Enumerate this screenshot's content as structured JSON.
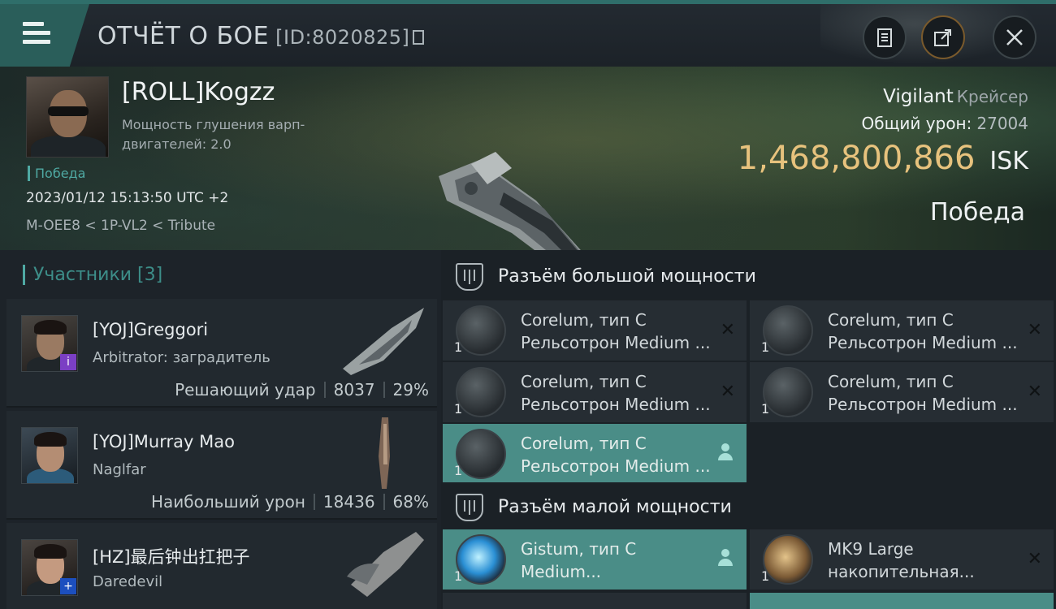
{
  "header": {
    "title": "ОТЧЁТ О БОЕ",
    "report_id": "[ID:8020825]"
  },
  "victim": {
    "pilot_name": "[ROLL]Kogzz",
    "pilot_sub": "Мощность глушения варп-двигателей: 2.0",
    "tag": "Победа",
    "timestamp": "2023/01/12 15:13:50 UTC +2",
    "location": "M-OEE8 < 1P-VL2 < Tribute",
    "ship_name": "Vigilant",
    "ship_class": "Крейсер",
    "damage_label": "Общий урон:",
    "damage_value": "27004",
    "isk_value": "1,468,800,866",
    "isk_unit": "ISK",
    "result": "Победа"
  },
  "participants": {
    "header": "Участники [3]",
    "items": [
      {
        "name": "[YOJ]Greggori",
        "ship": "Arbitrator: заградитель",
        "stat_label": "Решающий удар",
        "damage": "8037",
        "percent": "29%",
        "badge_color": "#7b3fc4",
        "badge_glyph": "i"
      },
      {
        "name": "[YOJ]Murray Mao",
        "ship": "Naglfar",
        "stat_label": "Наибольший урон",
        "damage": "18436",
        "percent": "68%"
      },
      {
        "name": "[HZ]最后钟出扛把子",
        "ship": "Daredevil",
        "badge_color": "#1c4fbf",
        "badge_glyph": "+"
      }
    ]
  },
  "fitting": {
    "high_slots_title": "Разъём большой мощности",
    "low_slots_title": "Разъём малой мощности",
    "high_modules": [
      {
        "line1": "Corelum, тип C",
        "line2": "Рельсотрон Medium ...",
        "qty": "1",
        "state": "destroyed"
      },
      {
        "line1": "Corelum, тип C",
        "line2": "Рельсотрон Medium ...",
        "qty": "1",
        "state": "destroyed"
      },
      {
        "line1": "Corelum, тип C",
        "line2": "Рельсотрон Medium ...",
        "qty": "1",
        "state": "destroyed"
      },
      {
        "line1": "Corelum, тип C",
        "line2": "Рельсотрон Medium ...",
        "qty": "1",
        "state": "destroyed"
      },
      {
        "line1": "Corelum, тип C",
        "line2": "Рельсотрон Medium ...",
        "qty": "1",
        "state": "dropped"
      }
    ],
    "low_modules": [
      {
        "line1": "Gistum, тип C",
        "line2": "Medium...",
        "qty": "1",
        "state": "dropped"
      },
      {
        "line1": "MK9 Large",
        "line2": "накопительная...",
        "qty": "1",
        "state": "destroyed"
      }
    ]
  },
  "colors": {
    "accent": "#4fa9a3",
    "isk": "#e7c27d",
    "active_slot": "#4a8d87"
  }
}
